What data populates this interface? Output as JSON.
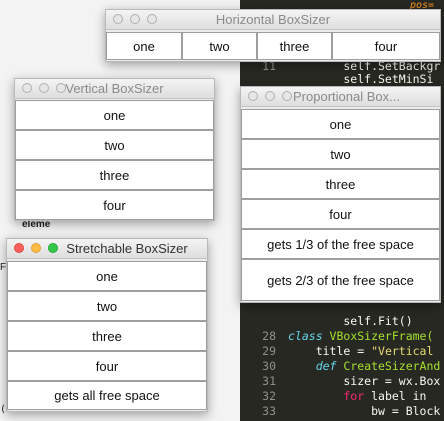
{
  "background": {
    "left_fragments": [
      "eleme",
      "Fr",
      "(wx.Fra",
      "pos="
    ],
    "code_lines": [
      {
        "n": "11",
        "tokens": [
          {
            "t": "        self.SetBackgr",
            "c": "w"
          }
        ]
      },
      {
        "n": "",
        "tokens": [
          {
            "t": "        self.SetMinSi",
            "c": "w"
          }
        ]
      },
      {
        "n": "",
        "tokens": [
          {
            "t": "        self.Fit()",
            "c": "w"
          }
        ]
      },
      {
        "n": "28",
        "tokens": [
          {
            "t": "class ",
            "c": "k"
          },
          {
            "t": "VBoxSizerFrame(",
            "c": "g"
          }
        ]
      },
      {
        "n": "29",
        "tokens": [
          {
            "t": "    title = ",
            "c": "w"
          },
          {
            "t": "\"Vertical",
            "c": "s"
          }
        ]
      },
      {
        "n": "30",
        "tokens": [
          {
            "t": "    def ",
            "c": "k"
          },
          {
            "t": "CreateSizerAnd",
            "c": "g"
          }
        ]
      },
      {
        "n": "31",
        "tokens": [
          {
            "t": "        sizer = wx.Box",
            "c": "w"
          }
        ]
      },
      {
        "n": "32",
        "tokens": [
          {
            "t": "        for ",
            "c": "kw"
          },
          {
            "t": "label in ",
            "c": "w"
          }
        ]
      },
      {
        "n": "33",
        "tokens": [
          {
            "t": "            bw = Block",
            "c": "w"
          }
        ]
      }
    ]
  },
  "windows": {
    "horizontal": {
      "title": "Horizontal BoxSizer",
      "buttons": [
        "one",
        "two",
        "three",
        "four"
      ]
    },
    "vertical": {
      "title": "Vertical BoxSizer",
      "buttons": [
        "one",
        "two",
        "three",
        "four"
      ]
    },
    "proportional": {
      "title": "Proportional Box...",
      "buttons": [
        "one",
        "two",
        "three",
        "four",
        "gets 1/3 of the free space",
        "gets 2/3 of the free space"
      ]
    },
    "stretchable": {
      "title": "Stretchable BoxSizer",
      "buttons": [
        "one",
        "two",
        "three",
        "four",
        "gets all free space"
      ]
    }
  }
}
